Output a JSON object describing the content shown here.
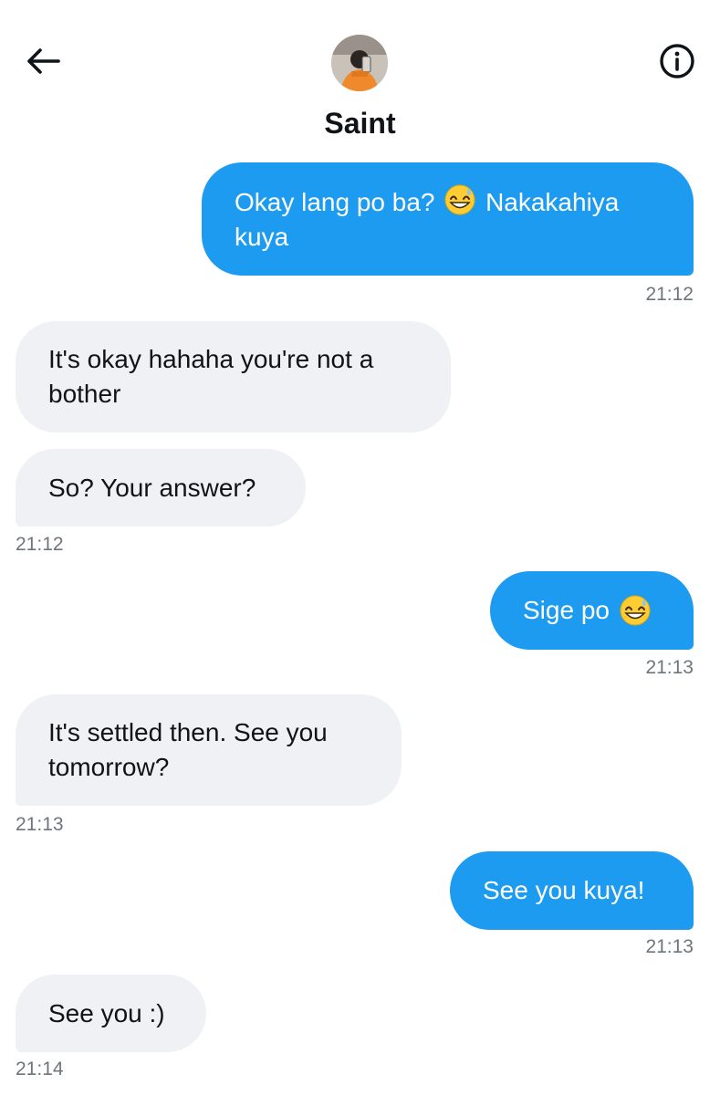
{
  "header": {
    "title": "Saint",
    "back_icon": "arrow-left-icon",
    "info_icon": "info-circle-icon",
    "avatar_icon": "avatar"
  },
  "colors": {
    "sent_bubble": "#1d9bf0",
    "received_bubble": "#eff1f4",
    "timestamp": "#6e767d"
  },
  "messages": [
    {
      "direction": "sent",
      "text_before": "Okay lang po ba?",
      "emoji": "grinning-face-with-sweat-emoji",
      "text_after": "Nakakahiya",
      "text_line2": "kuya"
    },
    {
      "direction": "sent_time",
      "time": "21:12"
    },
    {
      "direction": "received",
      "text": "It's okay hahaha you're not a bother"
    },
    {
      "direction": "received",
      "text": "So? Your answer?"
    },
    {
      "direction": "received_time",
      "time": "21:12"
    },
    {
      "direction": "sent",
      "text": "Sige po",
      "emoji": "grinning-face-with-sweat-emoji"
    },
    {
      "direction": "sent_time",
      "time": "21:13"
    },
    {
      "direction": "received",
      "text": "It's settled then. See you tomorrow?"
    },
    {
      "direction": "received_time",
      "time": "21:13"
    },
    {
      "direction": "sent",
      "text": "See you kuya!"
    },
    {
      "direction": "sent_time",
      "time": "21:13"
    },
    {
      "direction": "received",
      "text": "See you :)"
    },
    {
      "direction": "received_time",
      "time": "21:14"
    }
  ],
  "msg": {
    "m1_a": "Okay lang po ba?",
    "m1_b": "Nakakahiya",
    "m1_c": "kuya",
    "t1": "21:12",
    "m2_a": "It's okay hahaha you're not a",
    "m2_b": "bother",
    "m3": "So? Your answer?",
    "t2": "21:12",
    "m4": "Sige po",
    "t3": "21:13",
    "m5_a": "It's settled then. See you",
    "m5_b": "tomorrow?",
    "t4": "21:13",
    "m6": "See you kuya!",
    "t5": "21:13",
    "m7": "See you :)",
    "t6": "21:14"
  }
}
